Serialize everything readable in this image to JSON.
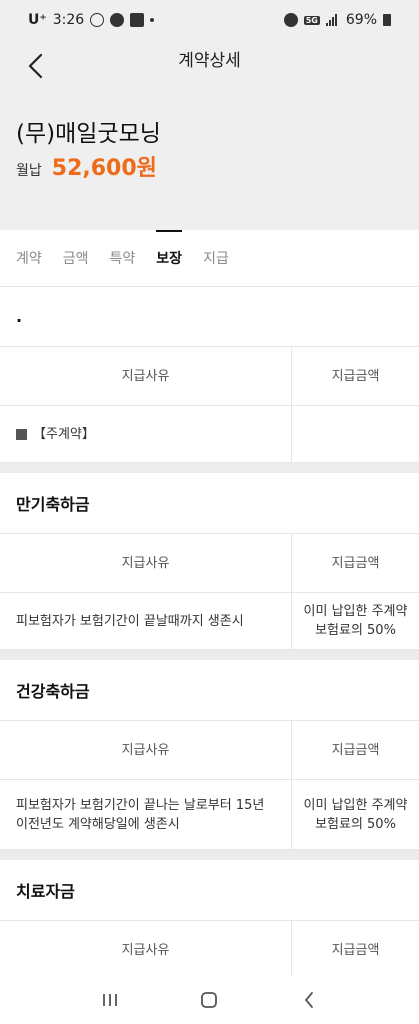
{
  "status_bar": {
    "carrier": "U⁺",
    "time": "3:26",
    "network": "5G",
    "battery": "69%"
  },
  "header": {
    "title": "계약상세",
    "product_name": "(무)매일굿모닝",
    "premium_label": "월납",
    "premium_value": "52,600원"
  },
  "tabs": [
    {
      "label": "계약",
      "active": false
    },
    {
      "label": "금액",
      "active": false
    },
    {
      "label": "특약",
      "active": false
    },
    {
      "label": "보장",
      "active": true
    },
    {
      "label": "지급",
      "active": false
    }
  ],
  "sections": [
    {
      "title": ".",
      "header": {
        "reason": "지급사유",
        "amount": "지급금액"
      },
      "row": {
        "reason": "【주계약】",
        "amount": ""
      }
    },
    {
      "title": "만기축하금",
      "header": {
        "reason": "지급사유",
        "amount": "지급금액"
      },
      "row": {
        "reason": "피보험자가 보험기간이 끝날때까지 생존시",
        "amount": "이미 납입한 주계약보험료의 50%"
      }
    },
    {
      "title": "건강축하금",
      "header": {
        "reason": "지급사유",
        "amount": "지급금액"
      },
      "row": {
        "reason": "피보험자가 보험기간이 끝나는 날로부터 15년 이전년도 계약해당일에 생존시",
        "amount": "이미 납입한 주계약보험료의 50%"
      }
    },
    {
      "title": "치료자금",
      "header": {
        "reason": "지급사유",
        "amount": "지급금액"
      }
    }
  ],
  "colors": {
    "accent": "#ee6b1c",
    "header_bg": "#efefef",
    "divider": "#e6e6e6"
  }
}
